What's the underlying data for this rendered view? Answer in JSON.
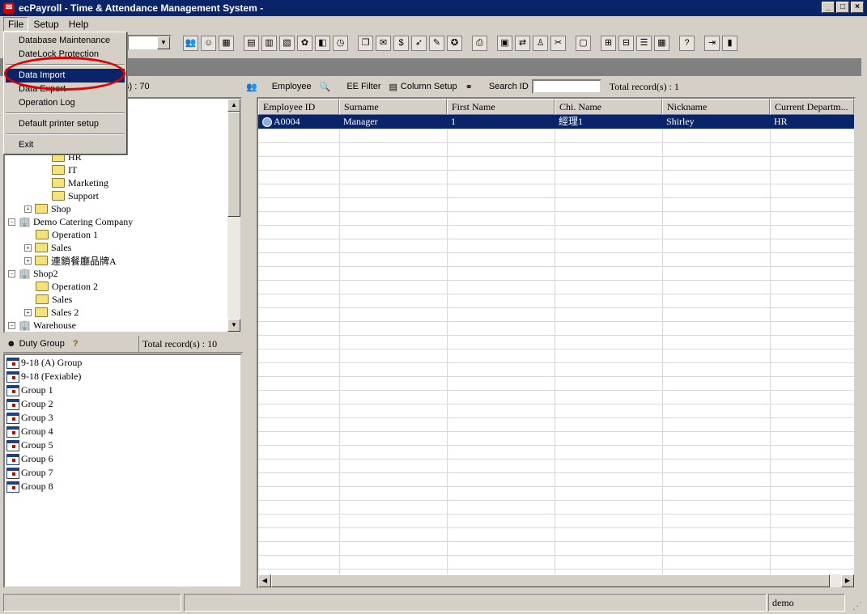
{
  "window": {
    "title": "ecPayroll - Time & Attendance Management System -"
  },
  "menubar": {
    "items": [
      "File",
      "Setup",
      "Help"
    ]
  },
  "file_menu": {
    "items": [
      "Database Maintenance",
      "DateLock Protection",
      "Data Import",
      "Data Export",
      "Operation Log",
      "Default printer setup",
      "Exit"
    ],
    "highlighted": "Data Import"
  },
  "dept_panel": {
    "record_count_text": "s) : 70"
  },
  "tree": {
    "nodes": [
      "HR",
      "IT",
      "Marketing",
      "Support",
      "Shop",
      "Demo Catering Company",
      "Operation 1",
      "Sales",
      "連鎖餐廳品牌A",
      "Shop2",
      "Operation 2",
      "Sales",
      "Sales 2",
      "Warehouse"
    ]
  },
  "duty": {
    "title": "Duty Group",
    "total_text": "Total record(s) : 10",
    "groups": [
      "9-18 (A) Group",
      "9-18 (Fexiable)",
      "Group 1",
      "Group 2",
      "Group 3",
      "Group 4",
      "Group 5",
      "Group 6",
      "Group 7",
      "Group 8"
    ]
  },
  "ee_bar": {
    "employee_label": "Employee",
    "filter_label": "EE Filter",
    "column_setup_label": "Column Setup",
    "search_label": "Search ID",
    "search_value": "",
    "total_text": "Total record(s) : 1"
  },
  "grid": {
    "columns": [
      "Employee ID",
      "Surname",
      "First Name",
      "Chi. Name",
      "Nickname",
      "Current Departm..."
    ],
    "rows": [
      [
        "A0004",
        "Manager",
        "1",
        "經理1",
        "Shirley",
        "HR"
      ]
    ]
  },
  "status": {
    "user": "demo"
  },
  "colors": {
    "title_bar": "#0a246a",
    "selection": "#0a246a",
    "highlight_circle": "#e00000"
  }
}
